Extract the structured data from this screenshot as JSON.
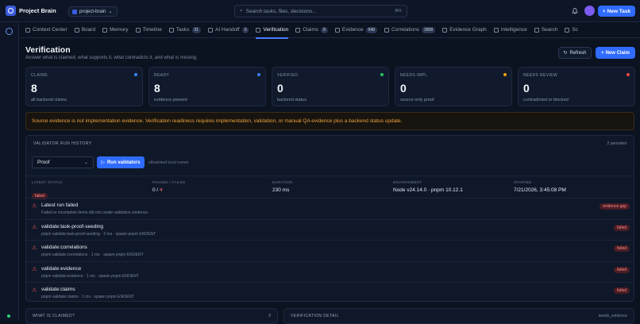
{
  "app": {
    "name": "Project Brain",
    "project": "project-brain",
    "search_placeholder": "Search tasks, files, decisions...",
    "search_kbd": "⌘K",
    "new_task": "New Task"
  },
  "tabs": [
    {
      "label": "Context Center",
      "icon": "target-icon",
      "count": ""
    },
    {
      "label": "Board",
      "icon": "board-icon",
      "count": ""
    },
    {
      "label": "Memory",
      "icon": "memory-icon",
      "count": ""
    },
    {
      "label": "Timeline",
      "icon": "timeline-icon",
      "count": ""
    },
    {
      "label": "Tasks",
      "icon": "tasks-icon",
      "count": "31"
    },
    {
      "label": "AI Handoff",
      "icon": "ai-icon",
      "count": "0"
    },
    {
      "label": "Verification",
      "icon": "verify-icon",
      "count": "",
      "active": true
    },
    {
      "label": "Claims",
      "icon": "claims-icon",
      "count": "8"
    },
    {
      "label": "Evidence",
      "icon": "evidence-icon",
      "count": "948"
    },
    {
      "label": "Correlations",
      "icon": "correlations-icon",
      "count": "2808"
    },
    {
      "label": "Evidence Graph",
      "icon": "graph-icon",
      "count": ""
    },
    {
      "label": "Intelligence",
      "icon": "intelligence-icon",
      "count": ""
    },
    {
      "label": "Search",
      "icon": "search-icon",
      "count": ""
    },
    {
      "label": "Sc",
      "icon": "sc-icon",
      "count": ""
    }
  ],
  "page": {
    "title": "Verification",
    "subtitle": "Answer what is claimed, what supports it, what contradicts it, and what is missing.",
    "refresh": "Refresh",
    "new_claim": "New Claim"
  },
  "cards": [
    {
      "label": "CLAIMS",
      "value": "8",
      "sub": "all backend claims",
      "color": "#3b82f6"
    },
    {
      "label": "READY",
      "value": "8",
      "sub": "evidence present",
      "color": "#3b82f6"
    },
    {
      "label": "VERIFIED",
      "value": "0",
      "sub": "backend status",
      "color": "#22c55e"
    },
    {
      "label": "NEEDS IMPL",
      "value": "0",
      "sub": "source-only proof",
      "color": "#f59e0b"
    },
    {
      "label": "NEEDS REVIEW",
      "value": "0",
      "sub": "contradicted or blocked",
      "color": "#ef4444"
    }
  ],
  "warning": "Source evidence is not implementation evidence. Verification readiness requires implementation, validation, or manual QA evidence plus a backend status update.",
  "validator": {
    "title": "VALIDATOR RUN HISTORY",
    "persisted": "2 persisted",
    "select": "Proof",
    "run": "Run validators",
    "note": "allowlisted local runner",
    "stats": {
      "latest_label": "LATEST STATUS",
      "latest": "failed",
      "passed_label": "PASSED / FAILED",
      "passed": "0",
      "sep": " / ",
      "failed": "4",
      "duration_label": "DURATION",
      "duration": "230 ms",
      "env_label": "ENVIRONMENT",
      "env": "Node v24.14.0 · pnpm 10.12.1",
      "started_label": "STARTED",
      "started": "7/21/2026, 3:45:08 PM"
    },
    "rows": [
      {
        "title": "Latest run failed",
        "sub": "Failed or incomplete items did not create validation evidence.",
        "badge": "evidence gap"
      },
      {
        "title": "validate:task-proof-seeding",
        "sub": "pnpm validate:task-proof-seeding · 2 ms · spawn pnpm ENOENT",
        "badge": "failed"
      },
      {
        "title": "validate:correlations",
        "sub": "pnpm validate:correlations · 1 ms · spawn pnpm ENOENT",
        "badge": "failed"
      },
      {
        "title": "validate:evidence",
        "sub": "pnpm validate:evidence · 1 ms · spawn pnpm ENOENT",
        "badge": "failed"
      },
      {
        "title": "validate:claims",
        "sub": "pnpm validate:claims · 1 ms · spawn pnpm ENOENT",
        "badge": "failed"
      }
    ]
  },
  "bottom": {
    "left_title": "WHAT IS CLAIMED?",
    "left_count": "8",
    "right_title": "VERIFICATION DETAIL",
    "right_status": "needs_evidence"
  }
}
